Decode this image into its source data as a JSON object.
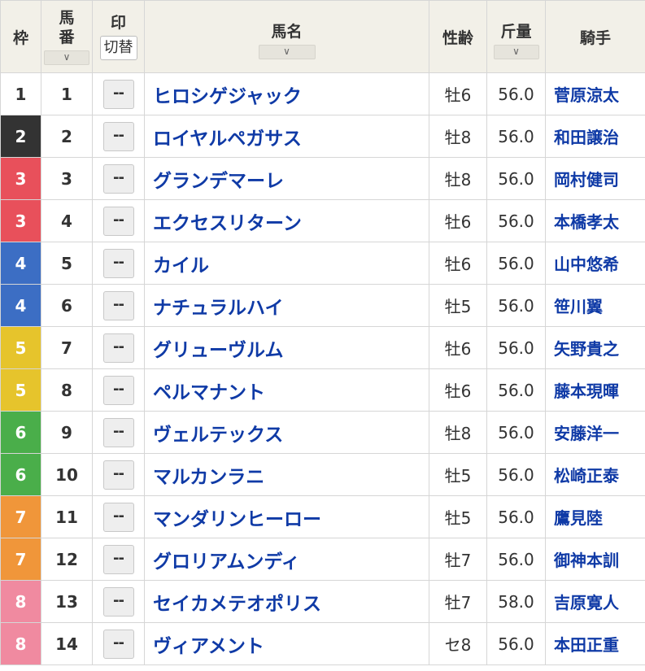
{
  "header": {
    "waku": "枠",
    "umaban_line1": "馬",
    "umaban_line2": "番",
    "mark": "印",
    "mark_toggle": "切替",
    "horse_name": "馬名",
    "sex_age": "性齢",
    "weight": "斤量",
    "jockey": "騎手",
    "sort_icon": "∨"
  },
  "mark_placeholder": "--",
  "waku_colors": {
    "1": {
      "bg": "#ffffff",
      "fg": "#333333"
    },
    "2": {
      "bg": "#333333",
      "fg": "#ffffff"
    },
    "3": {
      "bg": "#e8505b",
      "fg": "#ffffff"
    },
    "4": {
      "bg": "#3c6ec4",
      "fg": "#ffffff"
    },
    "5": {
      "bg": "#e6c42c",
      "fg": "#ffffff"
    },
    "6": {
      "bg": "#4aae4a",
      "fg": "#ffffff"
    },
    "7": {
      "bg": "#f0963a",
      "fg": "#ffffff"
    },
    "8": {
      "bg": "#f08aa0",
      "fg": "#ffffff"
    }
  },
  "rows": [
    {
      "waku": "1",
      "umaban": "1",
      "horse": "ヒロシゲジャック",
      "sex_age": "牡6",
      "weight": "56.0",
      "jockey": "菅原涼太"
    },
    {
      "waku": "2",
      "umaban": "2",
      "horse": "ロイヤルペガサス",
      "sex_age": "牡8",
      "weight": "56.0",
      "jockey": "和田譲治"
    },
    {
      "waku": "3",
      "umaban": "3",
      "horse": "グランデマーレ",
      "sex_age": "牡8",
      "weight": "56.0",
      "jockey": "岡村健司"
    },
    {
      "waku": "3",
      "umaban": "4",
      "horse": "エクセスリターン",
      "sex_age": "牡6",
      "weight": "56.0",
      "jockey": "本橋孝太"
    },
    {
      "waku": "4",
      "umaban": "5",
      "horse": "カイル",
      "sex_age": "牡6",
      "weight": "56.0",
      "jockey": "山中悠希"
    },
    {
      "waku": "4",
      "umaban": "6",
      "horse": "ナチュラルハイ",
      "sex_age": "牡5",
      "weight": "56.0",
      "jockey": "笹川翼"
    },
    {
      "waku": "5",
      "umaban": "7",
      "horse": "グリューヴルム",
      "sex_age": "牡6",
      "weight": "56.0",
      "jockey": "矢野貴之"
    },
    {
      "waku": "5",
      "umaban": "8",
      "horse": "ペルマナント",
      "sex_age": "牡6",
      "weight": "56.0",
      "jockey": "藤本現暉"
    },
    {
      "waku": "6",
      "umaban": "9",
      "horse": "ヴェルテックス",
      "sex_age": "牡8",
      "weight": "56.0",
      "jockey": "安藤洋一"
    },
    {
      "waku": "6",
      "umaban": "10",
      "horse": "マルカンラニ",
      "sex_age": "牡5",
      "weight": "56.0",
      "jockey": "松崎正泰"
    },
    {
      "waku": "7",
      "umaban": "11",
      "horse": "マンダリンヒーロー",
      "sex_age": "牡5",
      "weight": "56.0",
      "jockey": "鷹見陸"
    },
    {
      "waku": "7",
      "umaban": "12",
      "horse": "グロリアムンディ",
      "sex_age": "牡7",
      "weight": "56.0",
      "jockey": "御神本訓"
    },
    {
      "waku": "8",
      "umaban": "13",
      "horse": "セイカメテオポリス",
      "sex_age": "牡7",
      "weight": "58.0",
      "jockey": "吉原寛人"
    },
    {
      "waku": "8",
      "umaban": "14",
      "horse": "ヴィアメント",
      "sex_age": "セ8",
      "weight": "56.0",
      "jockey": "本田正重"
    }
  ]
}
